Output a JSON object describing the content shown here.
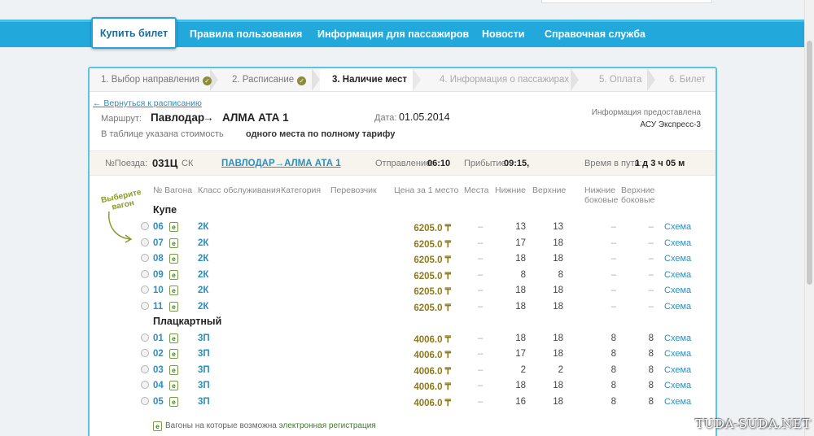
{
  "nav": {
    "active": "Купить билет",
    "items": [
      "Правила пользования",
      "Информация для пассажиров",
      "Новости",
      "Справочная служба"
    ]
  },
  "steps": [
    {
      "label": "1. Выбор направления",
      "state": "done"
    },
    {
      "label": "2. Расписание",
      "state": "done"
    },
    {
      "label": "3. Наличие мест",
      "state": "current"
    },
    {
      "label": "4. Информация о пассажирах",
      "state": "future"
    },
    {
      "label": "5. Оплата",
      "state": "future"
    },
    {
      "label": "6. Билет",
      "state": "future"
    }
  ],
  "back_link": "← Вернуться к расписанию",
  "route": {
    "label": "Маршрут:",
    "from": "Павлодар",
    "arrow": "→",
    "to": "АЛМА АТА 1",
    "date_label": "Дата:",
    "date": "01.05.2014",
    "note_prefix": "В таблице указана стоимость",
    "note_bold": "одного места по полному тарифу"
  },
  "provider": {
    "line1": "Информация предоставлена",
    "line2": "АСУ Экспресс-3"
  },
  "train": {
    "number_label": "№Поезда:",
    "number": "031Ц",
    "type": "СК",
    "route": "ПАВЛОДАР→АЛМА АТА 1",
    "departure_label": "Отправление:",
    "departure": "06:10",
    "arrival_label": "Прибытие:",
    "arrival": "09:15,",
    "duration_label": "Время в пути:",
    "duration": "1 д 3 ч 05 м"
  },
  "choose_hint": "Выберите вагон",
  "headers": {
    "wagon": "№ Вагона",
    "service": "Класс обслуживания",
    "category": "Категория",
    "carrier": "Перевозчик",
    "price": "Цена за 1 место",
    "seats": "Места",
    "lower": "Нижние",
    "upper": "Верхние",
    "lower_side": "Нижние боковые",
    "upper_side": "Верхние боковые"
  },
  "groups": [
    {
      "name": "Купе",
      "wagons": [
        {
          "num": "06",
          "cls": "2К",
          "price": "6205.0 ₸",
          "seats": "–",
          "lower": "13",
          "upper": "13",
          "lower_side": "–",
          "upper_side": "–",
          "link": "Схема"
        },
        {
          "num": "07",
          "cls": "2К",
          "price": "6205.0 ₸",
          "seats": "–",
          "lower": "17",
          "upper": "18",
          "lower_side": "–",
          "upper_side": "–",
          "link": "Схема"
        },
        {
          "num": "08",
          "cls": "2К",
          "price": "6205.0 ₸",
          "seats": "–",
          "lower": "18",
          "upper": "18",
          "lower_side": "–",
          "upper_side": "–",
          "link": "Схема"
        },
        {
          "num": "09",
          "cls": "2К",
          "price": "6205.0 ₸",
          "seats": "–",
          "lower": "8",
          "upper": "8",
          "lower_side": "–",
          "upper_side": "–",
          "link": "Схема"
        },
        {
          "num": "10",
          "cls": "2К",
          "price": "6205.0 ₸",
          "seats": "–",
          "lower": "18",
          "upper": "18",
          "lower_side": "–",
          "upper_side": "–",
          "link": "Схема"
        },
        {
          "num": "11",
          "cls": "2К",
          "price": "6205.0 ₸",
          "seats": "–",
          "lower": "18",
          "upper": "18",
          "lower_side": "–",
          "upper_side": "–",
          "link": "Схема"
        }
      ]
    },
    {
      "name": "Плацкартный",
      "wagons": [
        {
          "num": "01",
          "cls": "3П",
          "price": "4006.0 ₸",
          "seats": "–",
          "lower": "18",
          "upper": "18",
          "lower_side": "8",
          "upper_side": "8",
          "link": "Схема"
        },
        {
          "num": "02",
          "cls": "3П",
          "price": "4006.0 ₸",
          "seats": "–",
          "lower": "17",
          "upper": "18",
          "lower_side": "8",
          "upper_side": "8",
          "link": "Схема"
        },
        {
          "num": "03",
          "cls": "3П",
          "price": "4006.0 ₸",
          "seats": "–",
          "lower": "2",
          "upper": "2",
          "lower_side": "8",
          "upper_side": "8",
          "link": "Схема"
        },
        {
          "num": "04",
          "cls": "3П",
          "price": "4006.0 ₸",
          "seats": "–",
          "lower": "18",
          "upper": "18",
          "lower_side": "8",
          "upper_side": "8",
          "link": "Схема"
        },
        {
          "num": "05",
          "cls": "3П",
          "price": "4006.0 ₸",
          "seats": "–",
          "lower": "16",
          "upper": "18",
          "lower_side": "8",
          "upper_side": "8",
          "link": "Схема"
        }
      ]
    }
  ],
  "ebadge": "e",
  "footnote": {
    "prefix": "Вагоны на которые возможна",
    "bold": "электронная регистрация"
  },
  "watermark": "TUDA-SUDA.NET",
  "colors": {
    "nav": "#23a8dc",
    "link": "#2a8fbf",
    "price": "#8c7a1e",
    "panel_border": "#58c4e8"
  }
}
